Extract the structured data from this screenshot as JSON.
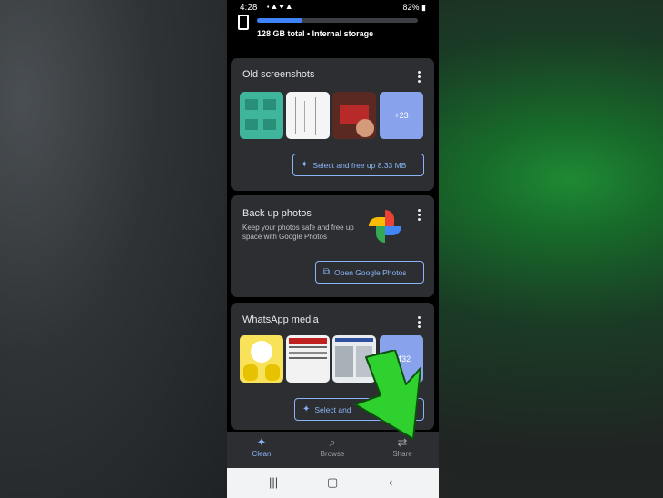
{
  "status_bar": {
    "time": "4:28",
    "battery": "82%"
  },
  "storage": {
    "label": "128 GB total • Internal storage",
    "used_fraction": 0.28
  },
  "cards": {
    "old_screenshots": {
      "title": "Old screenshots",
      "more_count": "+23",
      "action": "Select and free up 8.33 MB"
    },
    "backup": {
      "title": "Back up photos",
      "description": "Keep your photos safe and free up space with Google Photos",
      "action": "Open Google Photos"
    },
    "whatsapp": {
      "title": "WhatsApp media",
      "more_count": "+432",
      "action_left": "Select and",
      "action_right": "MB"
    }
  },
  "bottom_nav": [
    {
      "label": "Clean",
      "icon": "sparkle-icon"
    },
    {
      "label": "Browse",
      "icon": "browse-icon"
    },
    {
      "label": "Share",
      "icon": "share-icon"
    }
  ],
  "colors": {
    "accent": "#8ab4f8",
    "storage_fill": "#3e82f7",
    "card": "#2c2e31",
    "arrow": "#2ed12e"
  }
}
